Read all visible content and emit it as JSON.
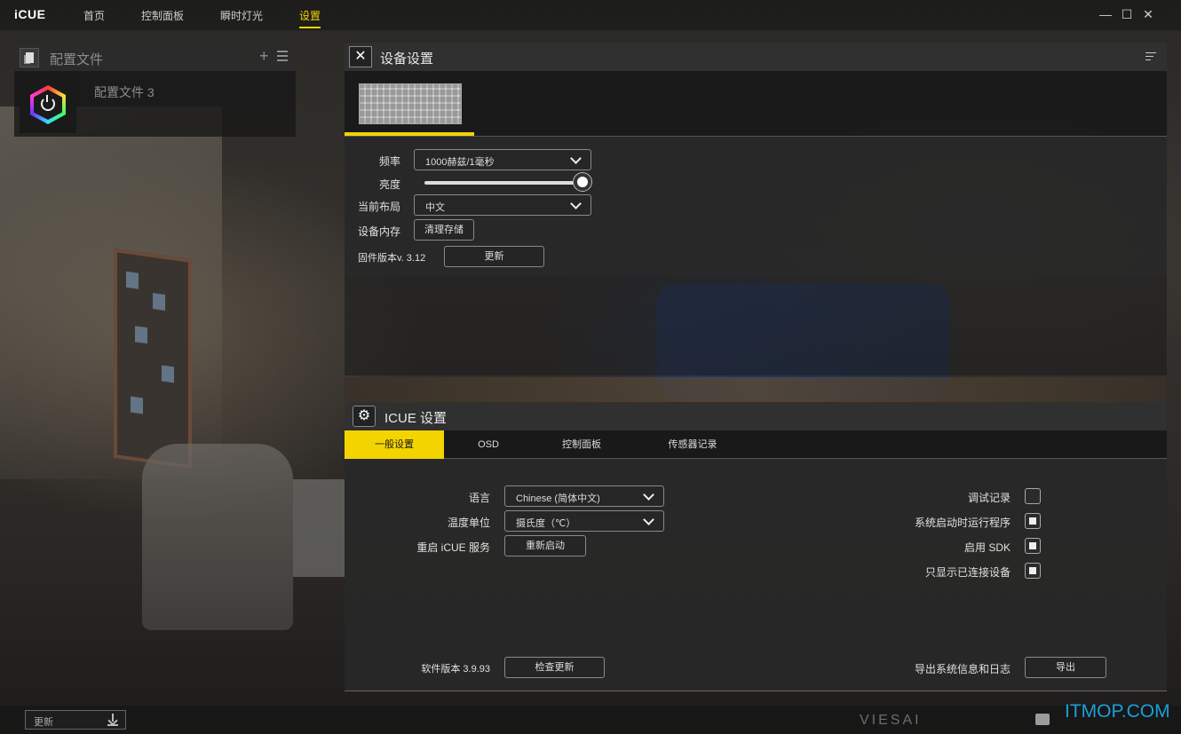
{
  "app": {
    "logo": "iCUE"
  },
  "nav": {
    "items": [
      "首页",
      "控制面板",
      "瞬时灯光",
      "设置"
    ],
    "active_index": 3
  },
  "window": {
    "minimize": "—",
    "maximize": "☐",
    "close": "✕"
  },
  "profiles": {
    "title": "配置文件",
    "add": "+",
    "items": [
      {
        "name": "配置文件 3"
      }
    ]
  },
  "device_settings": {
    "title": "设备设置",
    "frequency": {
      "label": "频率",
      "value": "1000赫兹/1毫秒"
    },
    "brightness": {
      "label": "亮度",
      "level": 1.0
    },
    "layout": {
      "label": "当前布局",
      "value": "中文"
    },
    "memory": {
      "label": "设备内存",
      "button": "清理存储"
    },
    "firmware": {
      "label": "固件版本v. 3.12",
      "button": "更新"
    }
  },
  "icue_settings": {
    "title": "ICUE 设置",
    "tabs": [
      "一般设置",
      "OSD",
      "控制面板",
      "传感器记录"
    ],
    "active_tab": 0,
    "language": {
      "label": "语言",
      "value": "Chinese (简体中文)"
    },
    "temperature": {
      "label": "温度单位",
      "value": "摄氏度（℃）"
    },
    "restart": {
      "label": "重启 iCUE 服务",
      "button": "重新启动"
    },
    "software": {
      "label": "软件版本 3.9.93",
      "button": "检查更新"
    },
    "options": [
      {
        "label": "调试记录",
        "checked": false
      },
      {
        "label": "系统启动时运行程序",
        "checked": true
      },
      {
        "label": "启用 SDK",
        "checked": true
      },
      {
        "label": "只显示已连接设备",
        "checked": true
      }
    ],
    "export": {
      "label": "导出系统信息和日志",
      "button": "导出"
    }
  },
  "bottom": {
    "update_label": "更新",
    "brand": "VIESAI"
  },
  "watermark": "ITMOP.COM",
  "colors": {
    "accent": "#f3d400",
    "watermark": "#1aa0d8"
  }
}
